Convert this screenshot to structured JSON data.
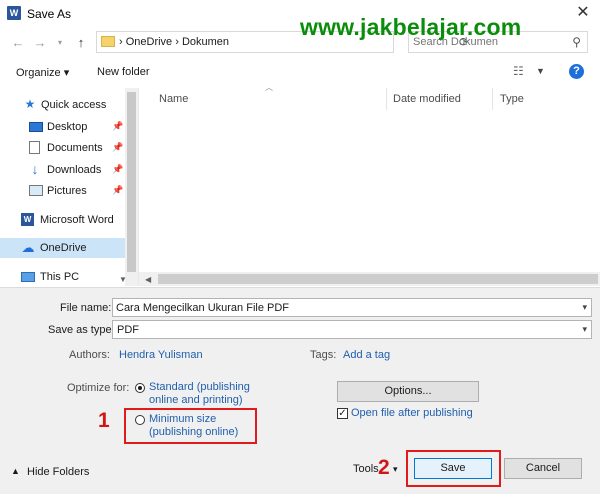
{
  "window": {
    "title": "Save As",
    "app_icon_letter": "W"
  },
  "nav": {
    "back_icon": "arrow-left-icon",
    "forward_icon": "arrow-right-icon",
    "recent_icon": "chevron-down-icon",
    "up_icon": "arrow-up-icon",
    "breadcrumb": "›  OneDrive  ›  Dokumen",
    "search_placeholder": "Search Dokumen"
  },
  "watermark": "www.jakbelajar.com",
  "toolbar": {
    "organize": "Organize ▾",
    "new_folder": "New folder"
  },
  "sidebar": {
    "items": [
      {
        "label": "Quick access"
      },
      {
        "label": "Desktop"
      },
      {
        "label": "Documents"
      },
      {
        "label": "Downloads"
      },
      {
        "label": "Pictures"
      },
      {
        "label": "Microsoft Word"
      },
      {
        "label": "OneDrive"
      },
      {
        "label": "This PC"
      }
    ]
  },
  "file_list": {
    "columns": [
      "Name",
      "Date modified",
      "Type"
    ]
  },
  "form": {
    "file_name_label": "File name:",
    "file_name_value": "Cara Mengecilkan Ukuran File PDF",
    "save_type_label": "Save as type:",
    "save_type_value": "PDF",
    "authors_label": "Authors:",
    "authors_value": "Hendra Yulisman",
    "tags_label": "Tags:",
    "tags_value": "Add a tag",
    "optimize_label": "Optimize for:",
    "opt_standard_line1": "Standard (publishing",
    "opt_standard_line2": "online and printing)",
    "opt_min_line1": "Minimum size",
    "opt_min_line2": "(publishing online)",
    "options_button": "Options...",
    "open_after_label": "Open file after publishing"
  },
  "footer": {
    "hide_folders": "Hide Folders",
    "tools": "Tools",
    "save": "Save",
    "cancel": "Cancel"
  },
  "annotations": {
    "step1": "1",
    "step2": "2"
  },
  "colors": {
    "accent": "#1e6fd9",
    "highlight": "#e01b1b",
    "watermark": "#0a8d0a",
    "selected": "#cce4f7"
  }
}
